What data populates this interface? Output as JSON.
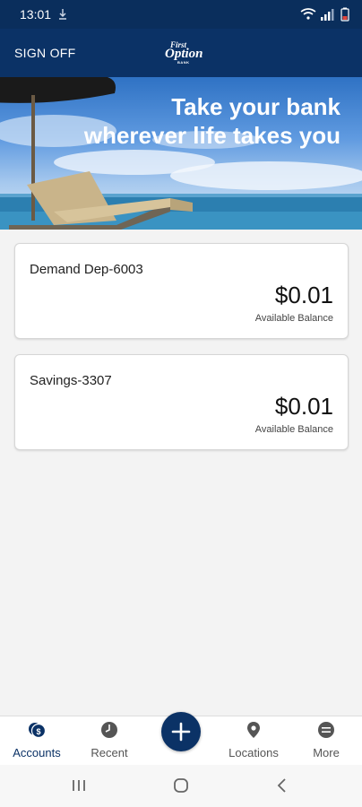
{
  "status_bar": {
    "time": "13:01"
  },
  "header": {
    "sign_off": "SIGN OFF",
    "logo_line1": "First",
    "logo_line2": "Option",
    "logo_line3": "BANK"
  },
  "banner": {
    "line1": "Take your bank",
    "line2": "wherever life takes you"
  },
  "accounts": [
    {
      "name": "Demand Dep-6003",
      "balance": "$0.01",
      "balance_label": "Available Balance"
    },
    {
      "name": "Savings-3307",
      "balance": "$0.01",
      "balance_label": "Available Balance"
    }
  ],
  "bottom_nav": {
    "items": [
      {
        "label": "Accounts",
        "icon": "dollar-coin-icon",
        "active": true
      },
      {
        "label": "Recent",
        "icon": "clock-icon",
        "active": false
      },
      {
        "label": "Locations",
        "icon": "map-pin-icon",
        "active": false
      },
      {
        "label": "More",
        "icon": "more-menu-icon",
        "active": false
      }
    ],
    "fab_icon": "plus-icon"
  },
  "colors": {
    "brand": "#0b3266",
    "status_bar": "#0a2e5c",
    "background": "#f3f3f3"
  }
}
